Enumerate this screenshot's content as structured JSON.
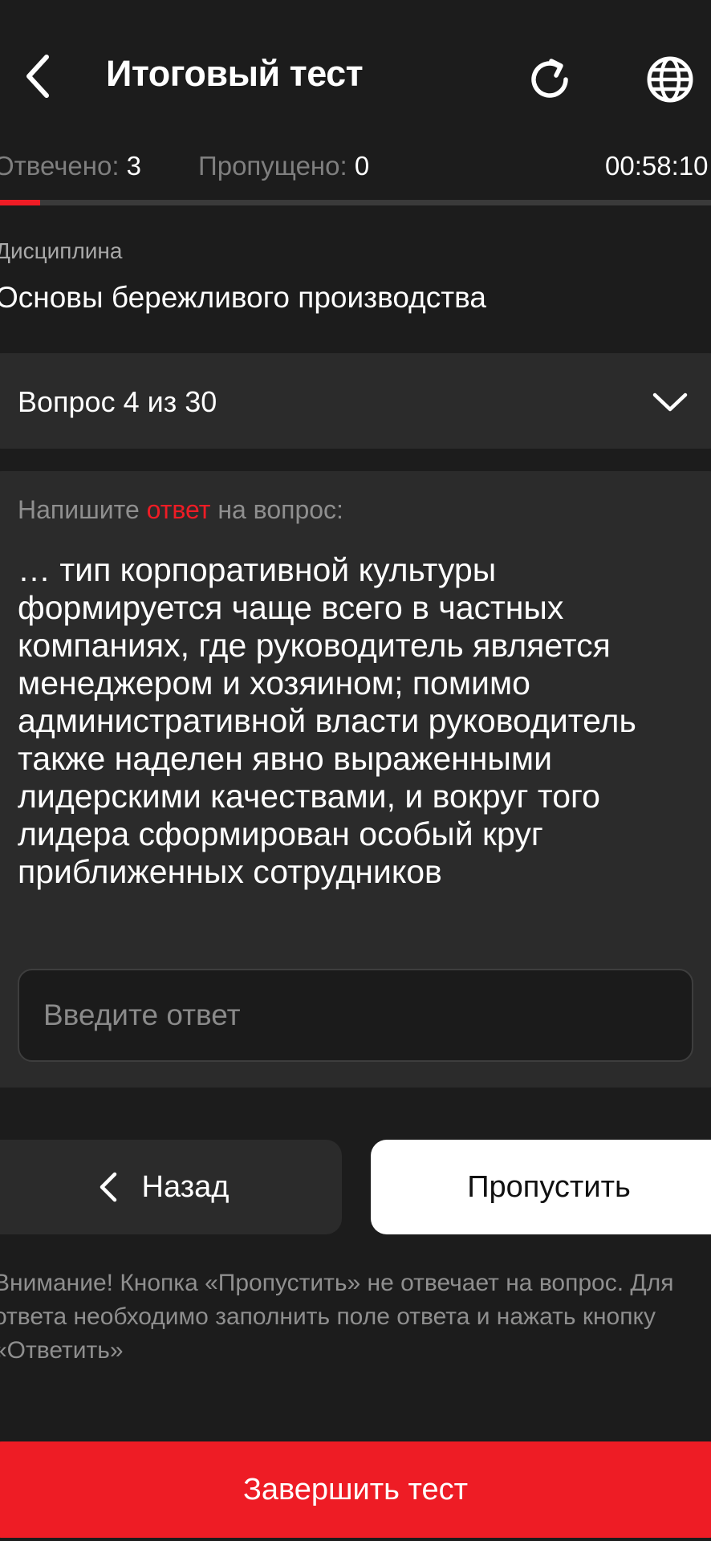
{
  "header": {
    "title": "Итоговый тест",
    "back_icon": "chevron-left-icon",
    "refresh_icon": "refresh-icon",
    "language_icon": "globe-icon"
  },
  "stats": {
    "answered_label": "Отвечено:",
    "answered_value": "3",
    "skipped_label": "Пропущено:",
    "skipped_value": "0",
    "timer": "00:58:10"
  },
  "progress": {
    "fraction": 0.0567
  },
  "discipline": {
    "label": "Дисциплина",
    "name": "Основы бережливого производства"
  },
  "question_select": {
    "label": "Вопрос 4 из 30",
    "icon": "chevron-down-icon"
  },
  "question": {
    "prompt_before": "Напишите ",
    "prompt_accent": "ответ",
    "prompt_after": " на вопрос:",
    "text": "… тип корпоративной культуры формируется чаще всего в частных компаниях, где руководитель является менеджером и хозяином; помимо административной власти руководитель также наделен явно выраженными лидерскими качествами, и вокруг того лидера сформирован особый круг приближенных сотрудников",
    "answer_value": "",
    "answer_placeholder": "Введите ответ"
  },
  "buttons": {
    "back_label": "Назад",
    "skip_label": "Пропустить",
    "finish_label": "Завершить тест"
  },
  "notice": "Внимание! Кнопка «Пропустить» не отвечает на вопрос. Для ответа необходимо заполнить поле ответа и нажать кнопку «Ответить»",
  "colors": {
    "background": "#1c1c1c",
    "card": "#2b2b2b",
    "accent": "#ee1c25",
    "muted_text": "#8f8f8f"
  }
}
